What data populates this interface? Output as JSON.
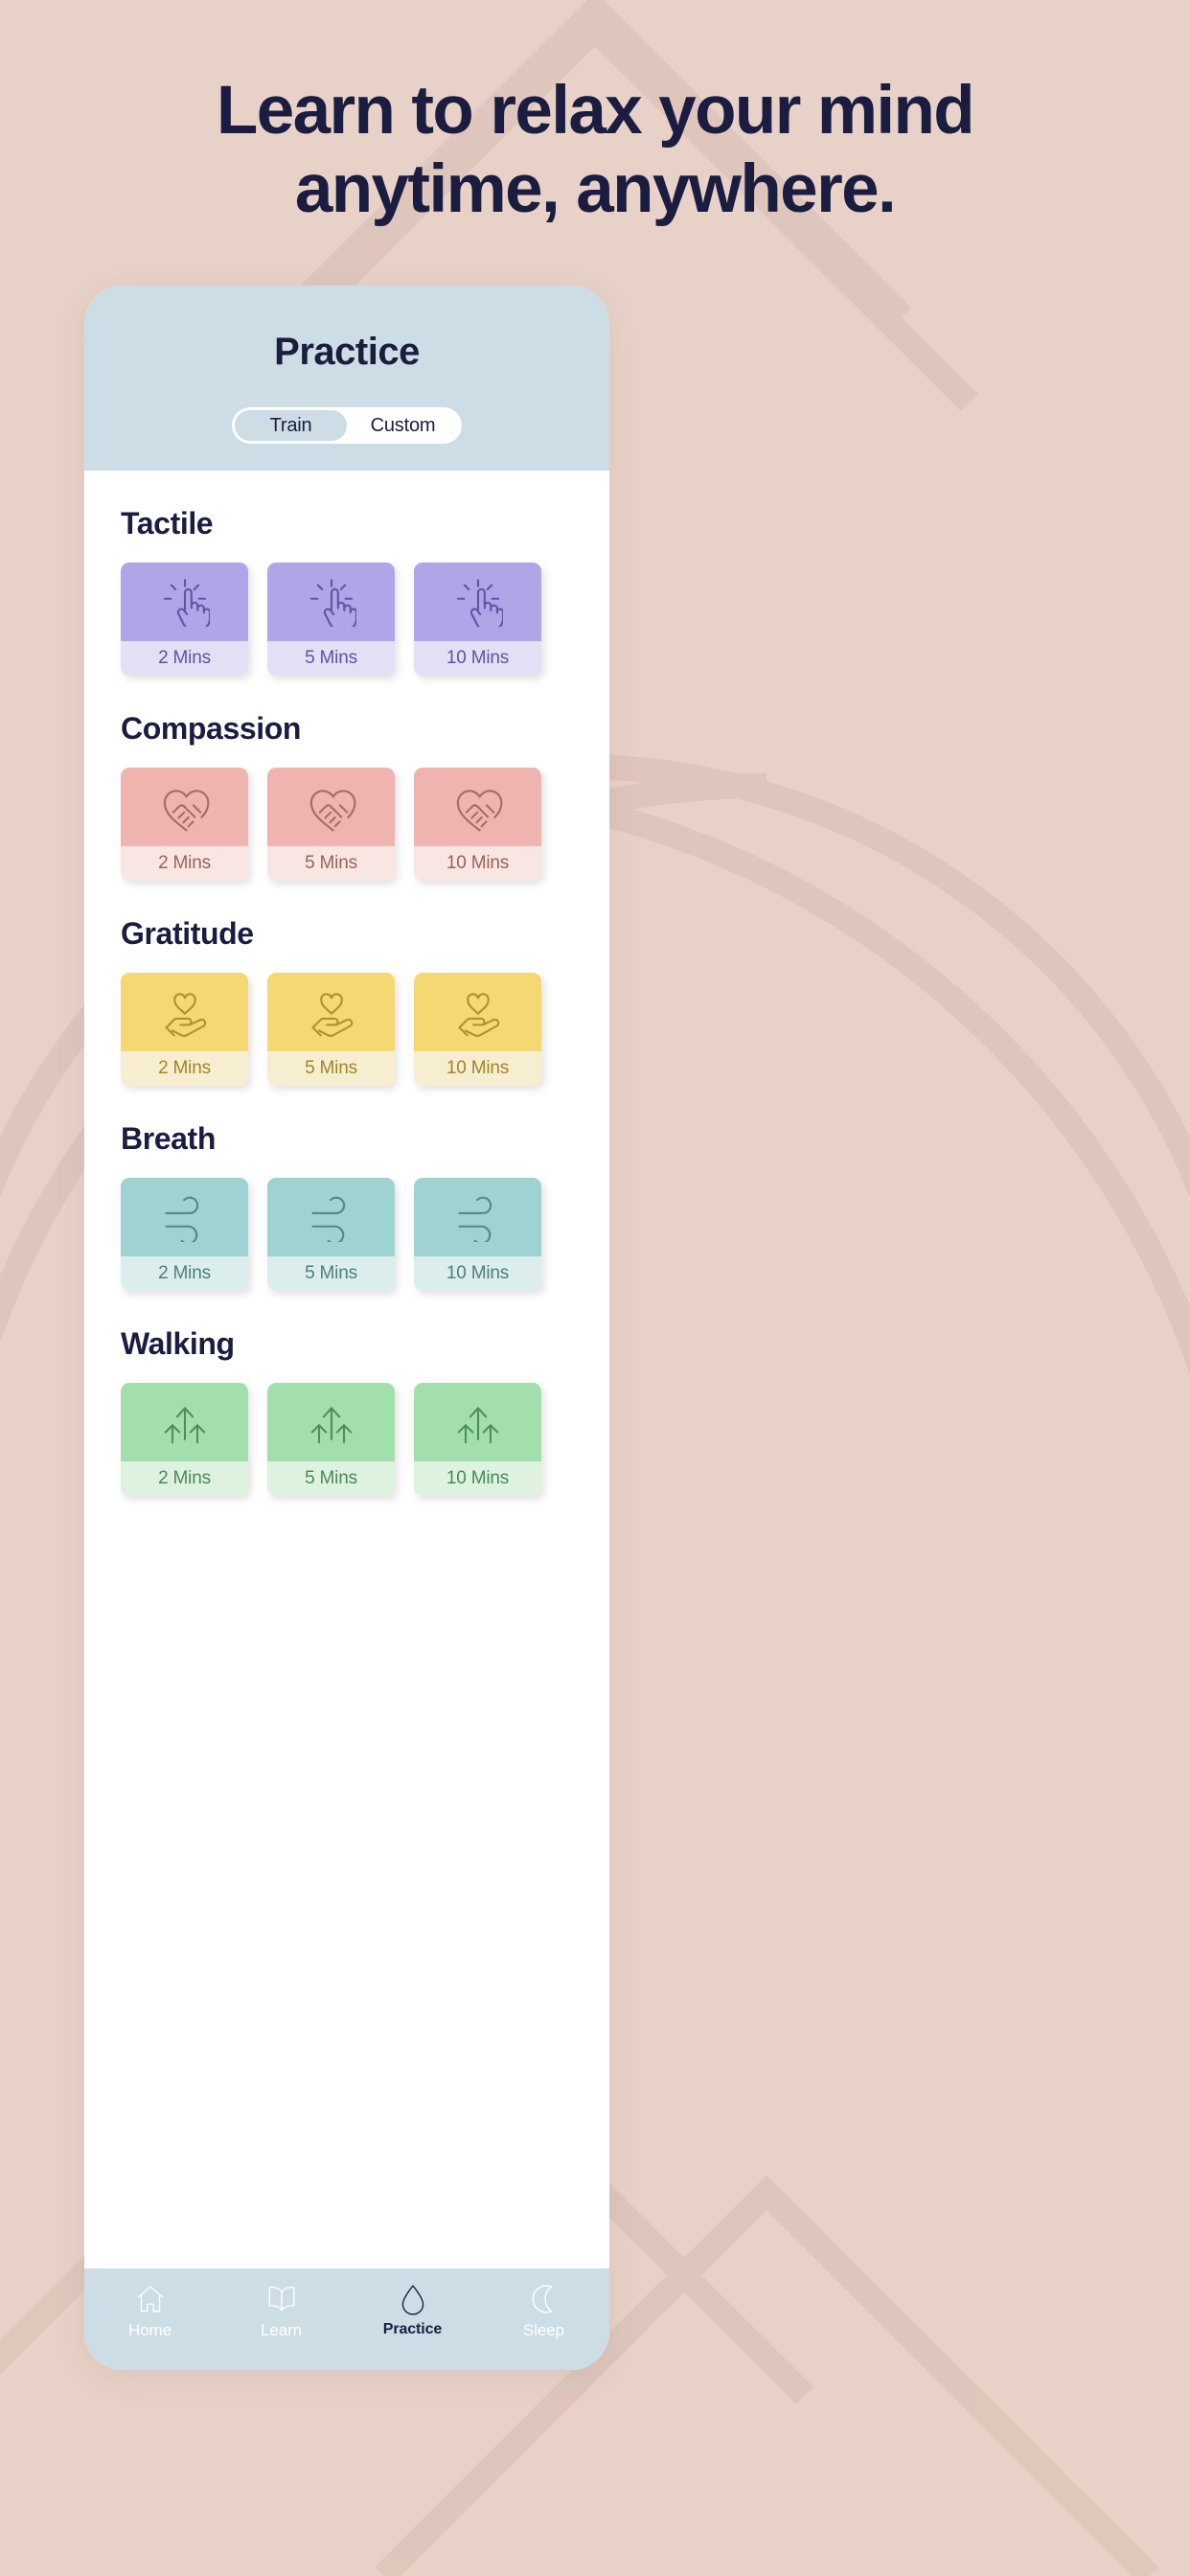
{
  "theme": {
    "background": "#e8d2c8",
    "ink": "#1b1d40",
    "header_blue": "#ccdde5",
    "card_surface": "#ffffff"
  },
  "headline": {
    "line1": "Learn to relax your mind",
    "line2": "anytime, anywhere."
  },
  "screen": {
    "title": "Practice",
    "toggle": {
      "options": [
        "Train",
        "Custom"
      ],
      "selected": "Train",
      "train_label": "Train",
      "custom_label": "Custom"
    }
  },
  "durations": [
    "2 Mins",
    "5 Mins",
    "10 Mins"
  ],
  "sections": [
    {
      "title": "Tactile",
      "icon": "tap-finger-icon",
      "top_color": "#afa6e8",
      "label_color": "#e3e0f5",
      "text_color": "#5c53a0",
      "stroke": "#5f56a5",
      "cards": [
        {
          "label": "2 Mins"
        },
        {
          "label": "5 Mins"
        },
        {
          "label": "10 Mins"
        }
      ]
    },
    {
      "title": "Compassion",
      "icon": "handshake-heart-icon",
      "top_color": "#efb4b0",
      "label_color": "#f8e6e3",
      "text_color": "#9b6257",
      "stroke": "#a66c60",
      "cards": [
        {
          "label": "2 Mins"
        },
        {
          "label": "5 Mins"
        },
        {
          "label": "10 Mins"
        }
      ]
    },
    {
      "title": "Gratitude",
      "icon": "hand-heart-icon",
      "top_color": "#f6d873",
      "label_color": "#f7eed2",
      "text_color": "#a08525",
      "stroke": "#b0912b",
      "cards": [
        {
          "label": "2 Mins"
        },
        {
          "label": "5 Mins"
        },
        {
          "label": "10 Mins"
        }
      ]
    },
    {
      "title": "Breath",
      "icon": "breath-wave-icon",
      "top_color": "#9fd2d2",
      "label_color": "#dceded",
      "text_color": "#4e7e7e",
      "stroke": "#5b8585",
      "cards": [
        {
          "label": "2 Mins"
        },
        {
          "label": "5 Mins"
        },
        {
          "label": "10 Mins"
        }
      ]
    },
    {
      "title": "Walking",
      "icon": "walking-arrow-icon",
      "top_color": "#a3dfac",
      "label_color": "#ddf2df",
      "text_color": "#4a8a57",
      "stroke": "#4f8f5c",
      "cards": [
        {
          "label": "2 Mins"
        },
        {
          "label": "5 Mins"
        },
        {
          "label": "10 Mins"
        }
      ]
    }
  ],
  "bottom_nav": {
    "items": [
      {
        "label": "Home",
        "icon": "home-icon",
        "active": false
      },
      {
        "label": "Learn",
        "icon": "book-icon",
        "active": false
      },
      {
        "label": "Practice",
        "icon": "droplet-icon",
        "active": true
      },
      {
        "label": "Sleep",
        "icon": "moon-icon",
        "active": false
      }
    ]
  }
}
